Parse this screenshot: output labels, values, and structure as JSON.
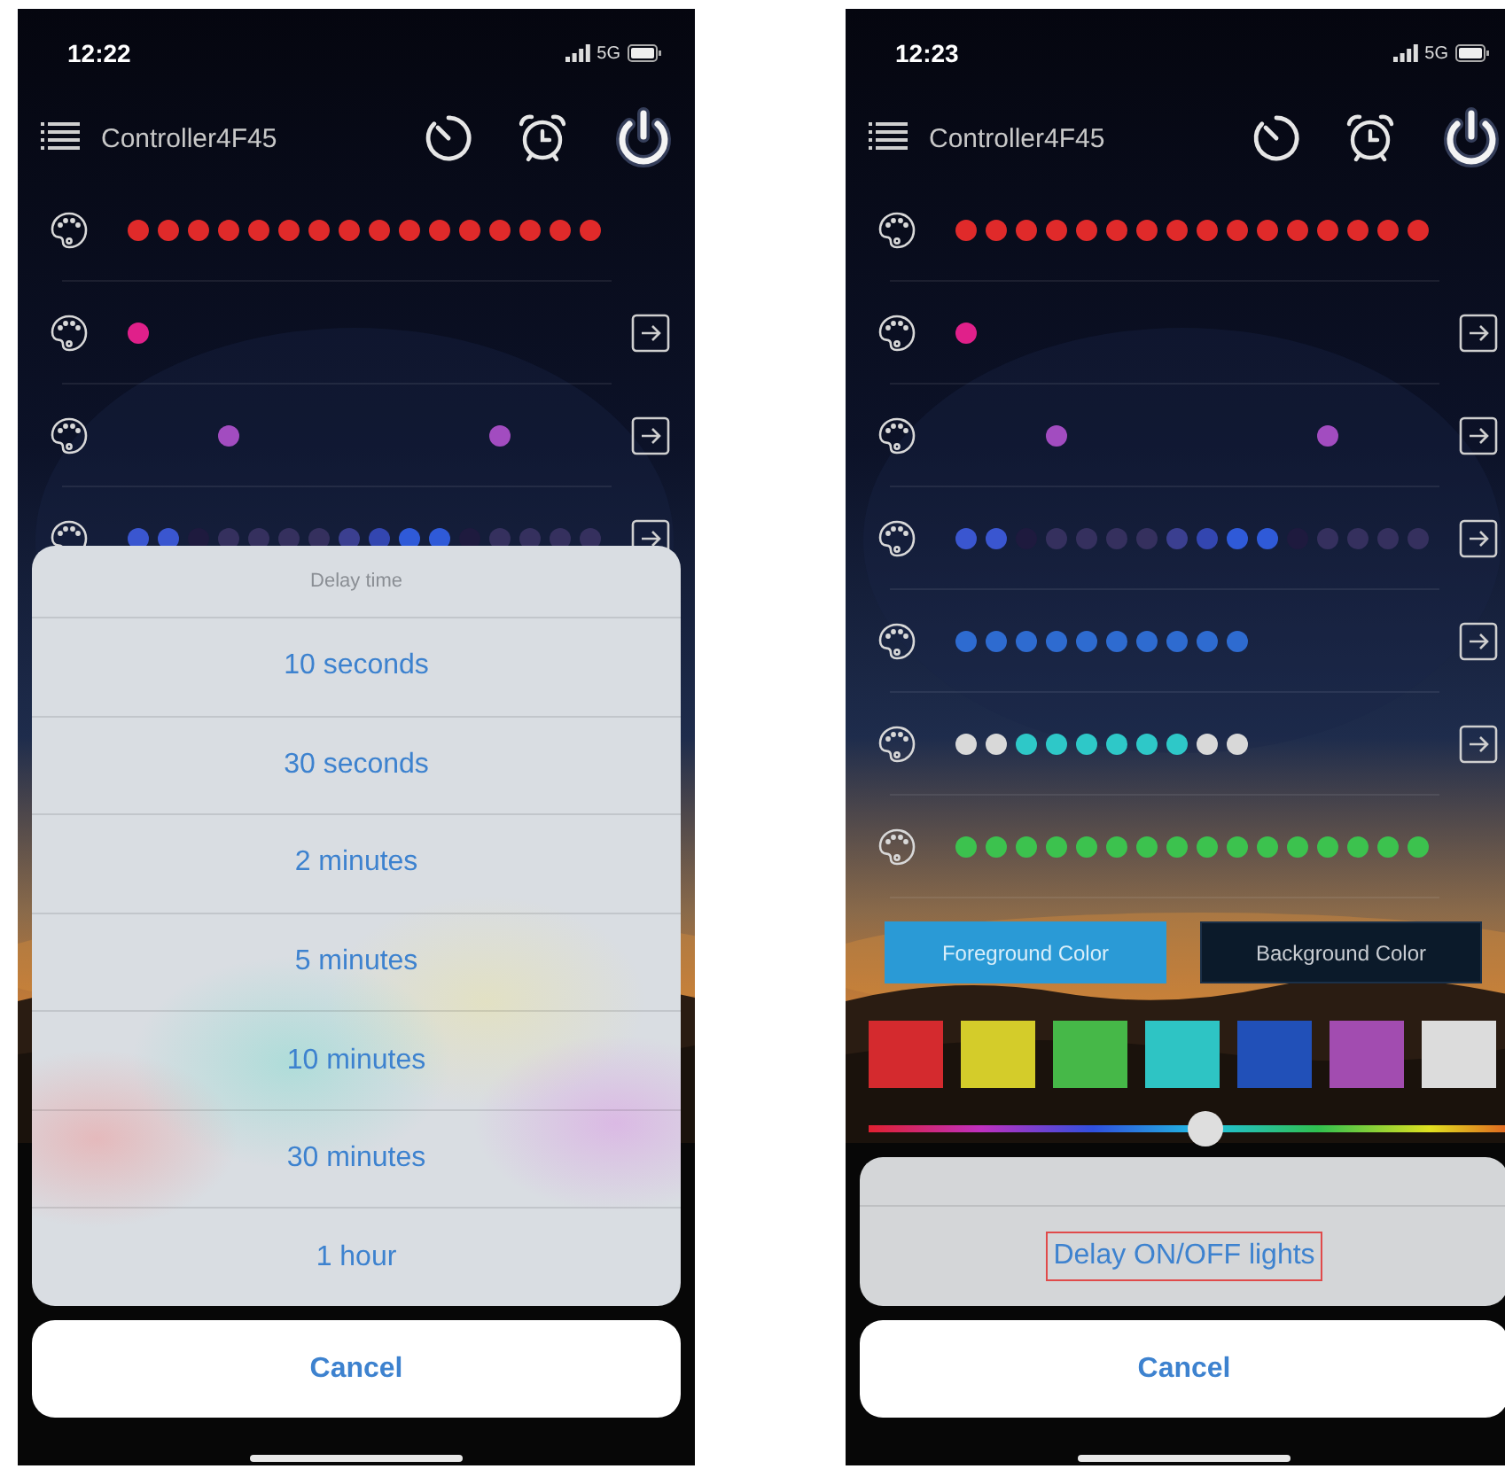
{
  "phones": [
    {
      "status_bar": {
        "time": "12:22",
        "network": "5G"
      },
      "header": {
        "title": "Controller4F45"
      },
      "rows": [
        {
          "arrow": false,
          "dots": [
            {
              "kind": "dot",
              "color": "#e02a2a"
            },
            {
              "kind": "dot",
              "color": "#e02a2a"
            },
            {
              "kind": "dot",
              "color": "#e02a2a"
            },
            {
              "kind": "dot",
              "color": "#e02a2a"
            },
            {
              "kind": "dot",
              "color": "#e02a2a"
            },
            {
              "kind": "dot",
              "color": "#e02a2a"
            },
            {
              "kind": "dot",
              "color": "#e02a2a"
            },
            {
              "kind": "dot",
              "color": "#e02a2a"
            },
            {
              "kind": "dot",
              "color": "#e02a2a"
            },
            {
              "kind": "dot",
              "color": "#e02a2a"
            },
            {
              "kind": "dot",
              "color": "#e02a2a"
            },
            {
              "kind": "dot",
              "color": "#e02a2a"
            },
            {
              "kind": "dot",
              "color": "#e02a2a"
            },
            {
              "kind": "dot",
              "color": "#e02a2a"
            },
            {
              "kind": "dot",
              "color": "#e02a2a"
            },
            {
              "kind": "dot",
              "color": "#e02a2a"
            }
          ]
        },
        {
          "arrow": true,
          "dots": [
            {
              "kind": "dot",
              "color": "#e0208a"
            }
          ]
        },
        {
          "arrow": true,
          "dots": [
            {
              "kind": "gap"
            },
            {
              "kind": "gap"
            },
            {
              "kind": "gap"
            },
            {
              "kind": "dot",
              "color": "#a24cc0"
            },
            {
              "kind": "gap"
            },
            {
              "kind": "gap"
            },
            {
              "kind": "gap"
            },
            {
              "kind": "gap"
            },
            {
              "kind": "gap"
            },
            {
              "kind": "gap"
            },
            {
              "kind": "gap"
            },
            {
              "kind": "gap"
            },
            {
              "kind": "dot",
              "color": "#a24cc0"
            }
          ]
        },
        {
          "arrow": true,
          "dots": [
            {
              "kind": "dot",
              "color": "#3a56d0"
            },
            {
              "kind": "dot",
              "color": "#3a56d0"
            },
            {
              "kind": "dot",
              "color": "#1e1a3e"
            },
            {
              "kind": "dot",
              "color": "#35305e"
            },
            {
              "kind": "dot",
              "color": "#35305e"
            },
            {
              "kind": "dot",
              "color": "#35305e"
            },
            {
              "kind": "dot",
              "color": "#35305e"
            },
            {
              "kind": "dot",
              "color": "#3b3f90"
            },
            {
              "kind": "dot",
              "color": "#3346b0"
            },
            {
              "kind": "dot",
              "color": "#2f5ad8"
            },
            {
              "kind": "dot",
              "color": "#2f5ad8"
            },
            {
              "kind": "dot",
              "color": "#1e1a3e"
            },
            {
              "kind": "dot",
              "color": "#35305e"
            },
            {
              "kind": "dot",
              "color": "#35305e"
            },
            {
              "kind": "dot",
              "color": "#35305e"
            },
            {
              "kind": "dot",
              "color": "#35305e"
            }
          ]
        }
      ],
      "sheet": {
        "title": "Delay time",
        "options": [
          {
            "label": "10 seconds",
            "highlighted": false
          },
          {
            "label": "30 seconds",
            "highlighted": false
          },
          {
            "label": "2 minutes",
            "highlighted": false
          },
          {
            "label": "5 minutes",
            "highlighted": false
          },
          {
            "label": "10 minutes",
            "highlighted": false
          },
          {
            "label": "30 minutes",
            "highlighted": false
          },
          {
            "label": "1 hour",
            "highlighted": false
          }
        ],
        "cancel": "Cancel"
      }
    },
    {
      "status_bar": {
        "time": "12:23",
        "network": "5G"
      },
      "header": {
        "title": "Controller4F45"
      },
      "rows": [
        {
          "arrow": false,
          "dots": [
            {
              "kind": "dot",
              "color": "#e02a2a"
            },
            {
              "kind": "dot",
              "color": "#e02a2a"
            },
            {
              "kind": "dot",
              "color": "#e02a2a"
            },
            {
              "kind": "dot",
              "color": "#e02a2a"
            },
            {
              "kind": "dot",
              "color": "#e02a2a"
            },
            {
              "kind": "dot",
              "color": "#e02a2a"
            },
            {
              "kind": "dot",
              "color": "#e02a2a"
            },
            {
              "kind": "dot",
              "color": "#e02a2a"
            },
            {
              "kind": "dot",
              "color": "#e02a2a"
            },
            {
              "kind": "dot",
              "color": "#e02a2a"
            },
            {
              "kind": "dot",
              "color": "#e02a2a"
            },
            {
              "kind": "dot",
              "color": "#e02a2a"
            },
            {
              "kind": "dot",
              "color": "#e02a2a"
            },
            {
              "kind": "dot",
              "color": "#e02a2a"
            },
            {
              "kind": "dot",
              "color": "#e02a2a"
            },
            {
              "kind": "dot",
              "color": "#e02a2a"
            }
          ]
        },
        {
          "arrow": true,
          "dots": [
            {
              "kind": "dot",
              "color": "#e0208a"
            }
          ]
        },
        {
          "arrow": true,
          "dots": [
            {
              "kind": "gap"
            },
            {
              "kind": "gap"
            },
            {
              "kind": "gap"
            },
            {
              "kind": "dot",
              "color": "#a24cc0"
            },
            {
              "kind": "gap"
            },
            {
              "kind": "gap"
            },
            {
              "kind": "gap"
            },
            {
              "kind": "gap"
            },
            {
              "kind": "gap"
            },
            {
              "kind": "gap"
            },
            {
              "kind": "gap"
            },
            {
              "kind": "gap"
            },
            {
              "kind": "dot",
              "color": "#a24cc0"
            }
          ]
        },
        {
          "arrow": true,
          "dots": [
            {
              "kind": "dot",
              "color": "#3a56d0"
            },
            {
              "kind": "dot",
              "color": "#3a56d0"
            },
            {
              "kind": "dot",
              "color": "#1e1a3e"
            },
            {
              "kind": "dot",
              "color": "#35305e"
            },
            {
              "kind": "dot",
              "color": "#35305e"
            },
            {
              "kind": "dot",
              "color": "#35305e"
            },
            {
              "kind": "dot",
              "color": "#35305e"
            },
            {
              "kind": "dot",
              "color": "#3b3f90"
            },
            {
              "kind": "dot",
              "color": "#3346b0"
            },
            {
              "kind": "dot",
              "color": "#2f5ad8"
            },
            {
              "kind": "dot",
              "color": "#2f5ad8"
            },
            {
              "kind": "dot",
              "color": "#1e1a3e"
            },
            {
              "kind": "dot",
              "color": "#35305e"
            },
            {
              "kind": "dot",
              "color": "#35305e"
            },
            {
              "kind": "dot",
              "color": "#35305e"
            },
            {
              "kind": "dot",
              "color": "#35305e"
            }
          ]
        },
        {
          "arrow": true,
          "dots": [
            {
              "kind": "dot",
              "color": "#2e6bd0"
            },
            {
              "kind": "dot",
              "color": "#2e6bd0"
            },
            {
              "kind": "dot",
              "color": "#2e6bd0"
            },
            {
              "kind": "dot",
              "color": "#2e6bd0"
            },
            {
              "kind": "dot",
              "color": "#2e6bd0"
            },
            {
              "kind": "dot",
              "color": "#2e6bd0"
            },
            {
              "kind": "dot",
              "color": "#2e6bd0"
            },
            {
              "kind": "dot",
              "color": "#2e6bd0"
            },
            {
              "kind": "dot",
              "color": "#2e6bd0"
            },
            {
              "kind": "dot",
              "color": "#2e6bd0"
            }
          ]
        },
        {
          "arrow": true,
          "dots": [
            {
              "kind": "dot",
              "color": "#d8d8d8"
            },
            {
              "kind": "dot",
              "color": "#d8d8d8"
            },
            {
              "kind": "dot",
              "color": "#2ec8c8"
            },
            {
              "kind": "dot",
              "color": "#2ec8c8"
            },
            {
              "kind": "dot",
              "color": "#2ec8c8"
            },
            {
              "kind": "dot",
              "color": "#2ec8c8"
            },
            {
              "kind": "dot",
              "color": "#2ec8c8"
            },
            {
              "kind": "dot",
              "color": "#2ec8c8"
            },
            {
              "kind": "dot",
              "color": "#d8d8d8"
            },
            {
              "kind": "dot",
              "color": "#d8d8d8"
            }
          ]
        },
        {
          "arrow": false,
          "dots": [
            {
              "kind": "dot",
              "color": "#3cc24e"
            },
            {
              "kind": "dot",
              "color": "#3cc24e"
            },
            {
              "kind": "dot",
              "color": "#3cc24e"
            },
            {
              "kind": "dot",
              "color": "#3cc24e"
            },
            {
              "kind": "dot",
              "color": "#3cc24e"
            },
            {
              "kind": "dot",
              "color": "#3cc24e"
            },
            {
              "kind": "dot",
              "color": "#3cc24e"
            },
            {
              "kind": "dot",
              "color": "#3cc24e"
            },
            {
              "kind": "dot",
              "color": "#3cc24e"
            },
            {
              "kind": "dot",
              "color": "#3cc24e"
            },
            {
              "kind": "dot",
              "color": "#3cc24e"
            },
            {
              "kind": "dot",
              "color": "#3cc24e"
            },
            {
              "kind": "dot",
              "color": "#3cc24e"
            },
            {
              "kind": "dot",
              "color": "#3cc24e"
            },
            {
              "kind": "dot",
              "color": "#3cc24e"
            },
            {
              "kind": "dot",
              "color": "#3cc24e"
            }
          ]
        }
      ],
      "color_tabs": [
        {
          "label": "Foreground Color",
          "selected": true
        },
        {
          "label": "Background Color",
          "selected": false
        }
      ],
      "swatches": [
        {
          "color": "#d42a2e"
        },
        {
          "color": "#d4cc2a"
        },
        {
          "color": "#46b848"
        },
        {
          "color": "#2ec4c4"
        },
        {
          "color": "#2150b8"
        },
        {
          "color": "#a24cb0"
        },
        {
          "color": "#dcdcdc"
        }
      ],
      "slider": {
        "level": 0.5
      },
      "sheet": {
        "options": [
          {
            "label": "Delay ON/OFF lights",
            "highlighted": true
          }
        ],
        "cancel": "Cancel"
      }
    }
  ]
}
